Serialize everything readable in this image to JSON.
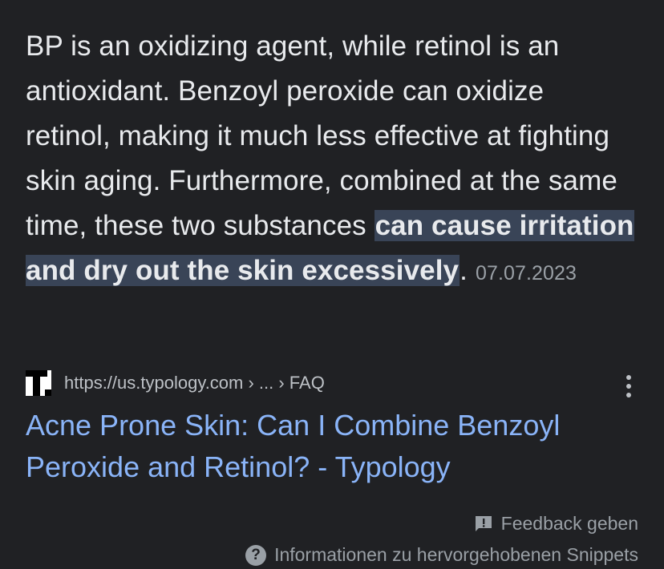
{
  "snippet": {
    "text_before": "BP is an oxidizing agent, while retinol is an antioxidant. Benzoyl peroxide can oxidize retinol, making it much less effective at fighting skin aging. Furthermore, combined at the same time, these two substances ",
    "highlight": "can cause irritation and dry out the skin excessively",
    "text_after": ".",
    "date": "07.07.2023"
  },
  "source": {
    "favicon": "typology-t-icon",
    "url": "https://us.typology.com › ... › FAQ"
  },
  "result": {
    "title": "Acne Prone Skin: Can I Combine Benzoyl Peroxide and Retinol? - Typology"
  },
  "footer": {
    "feedback_label": "Feedback geben",
    "feedback_icon": "feedback-icon",
    "info_label": "Informationen zu hervorgehobenen Snippets",
    "info_icon": "help-circle-icon"
  },
  "colors": {
    "background": "#202124",
    "text": "#e8eaed",
    "highlight_bg": "#394457",
    "link": "#8ab4f8",
    "muted": "#9aa0a6"
  }
}
